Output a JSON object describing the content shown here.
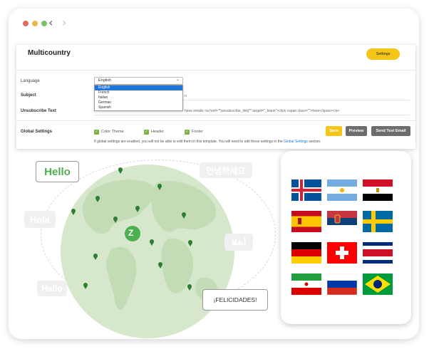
{
  "window": {
    "controls": [
      "close",
      "minimize",
      "zoom"
    ],
    "back_glyph": "‹",
    "forward_glyph": "›"
  },
  "panel": {
    "title": "Multicountry",
    "settings_button": "Settings",
    "language": {
      "label": "Language",
      "selected": "English",
      "options": [
        "English",
        "French",
        "Italian",
        "German",
        "Spanish"
      ]
    },
    "subject": {
      "label": "Subject",
      "value": "n"
    },
    "unsubscribe": {
      "label": "Unsubscribe Text",
      "value": "hese emails <a href=\"*|unsubscribe_link|*\" target=\"_blank\">click <span class=\"\">here</span></a>"
    },
    "global_settings": {
      "label": "Global Settings",
      "options": [
        {
          "label": "Color Theme",
          "checked": true
        },
        {
          "label": "Header",
          "checked": true
        },
        {
          "label": "Footer",
          "checked": true
        }
      ],
      "buttons": {
        "save": "Save",
        "preview": "Preview",
        "send_test": "Send Test Email"
      },
      "note_prefix": "If global settings are enabled, you will not be able to edit them in this template. You will need to edit these settings in the ",
      "note_link": "Global Settings",
      "note_suffix": " section."
    },
    "checkmark_glyph": "✓"
  },
  "illustration": {
    "logo_letter": "Z",
    "greetings": {
      "hello": "Hello",
      "hola": "Hola",
      "hallo": "Hallo",
      "korean": "안녕하세요",
      "arabic": "أهلا",
      "felicidades": "¡FELICIDADES!"
    }
  },
  "flags": [
    {
      "country": "Iceland"
    },
    {
      "country": "Argentina"
    },
    {
      "country": "Egypt"
    },
    {
      "country": "Spain"
    },
    {
      "country": "Serbia"
    },
    {
      "country": "Sweden"
    },
    {
      "country": "Germany"
    },
    {
      "country": "Switzerland"
    },
    {
      "country": "Costa Rica"
    },
    {
      "country": "Iran"
    },
    {
      "country": "Russia"
    },
    {
      "country": "Brazil"
    }
  ],
  "colors": {
    "accent_yellow": "#f5c518",
    "brand_green": "#4caf50",
    "checkbox_green": "#7cb342",
    "dark_button": "#6d6d6d",
    "link_blue": "#1e74d9",
    "globe_green": "#d6e7cc"
  }
}
